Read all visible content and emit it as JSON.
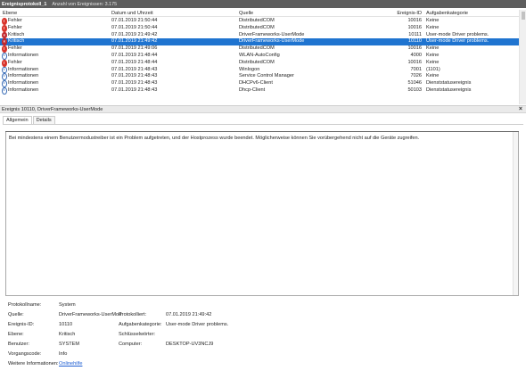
{
  "titlebar": {
    "name": "Ereignisprotokoll_1",
    "count": "Anzahl von Ereignissen: 3.175"
  },
  "columns": {
    "level": "Ebene",
    "date": "Datum und Uhrzeit",
    "source": "Quelle",
    "id": "Ereignis-ID",
    "category": "Aufgabenkategorie"
  },
  "rows": [
    {
      "icon": "err",
      "level": "Fehler",
      "date": "07.01.2019 21:50:44",
      "source": "DistributedCOM",
      "id": "10016",
      "category": "Keine"
    },
    {
      "icon": "err",
      "level": "Fehler",
      "date": "07.01.2019 21:50:44",
      "source": "DistributedCOM",
      "id": "10016",
      "category": "Keine"
    },
    {
      "icon": "crit",
      "level": "Kritisch",
      "date": "07.01.2019 21:49:42",
      "source": "DriverFrameworks-UserMode",
      "id": "10111",
      "category": "User-mode Driver problems."
    },
    {
      "icon": "crit",
      "level": "Kritisch",
      "date": "07.01.2019 21:49:42",
      "source": "DriverFrameworks-UserMode",
      "id": "10110",
      "category": "User-mode Driver problems."
    },
    {
      "icon": "err",
      "level": "Fehler",
      "date": "07.01.2019 21:49:06",
      "source": "DistributedCOM",
      "id": "10016",
      "category": "Keine"
    },
    {
      "icon": "info",
      "level": "Informationen",
      "date": "07.01.2019 21:48:44",
      "source": "WLAN-AutoConfig",
      "id": "4000",
      "category": "Keine"
    },
    {
      "icon": "err",
      "level": "Fehler",
      "date": "07.01.2019 21:48:44",
      "source": "DistributedCOM",
      "id": "10016",
      "category": "Keine"
    },
    {
      "icon": "info",
      "level": "Informationen",
      "date": "07.01.2019 21:48:43",
      "source": "Winlogon",
      "id": "7001",
      "category": "(1101)"
    },
    {
      "icon": "info",
      "level": "Informationen",
      "date": "07.01.2019 21:48:43",
      "source": "Service Control Manager",
      "id": "7026",
      "category": "Keine"
    },
    {
      "icon": "info",
      "level": "Informationen",
      "date": "07.01.2019 21:48:43",
      "source": "DHCPv6-Client",
      "id": "51046",
      "category": "Dienststatusereignis"
    },
    {
      "icon": "info",
      "level": "Informationen",
      "date": "07.01.2019 21:48:43",
      "source": "Dhcp-Client",
      "id": "50103",
      "category": "Dienststatusereignis"
    }
  ],
  "selected_row": 3,
  "detail": {
    "header": "Ereignis 10110, DriverFrameworks-UserMode",
    "tabs": [
      "Allgemein",
      "Details"
    ],
    "message": "Bei mindestens einem Benutzermodustreiber ist ein Problem aufgetreten, und der Hostprozess wurde beendet. Möglicherweise können Sie vorübergehend nicht auf die Geräte zugreifen."
  },
  "props": {
    "log_label": "Protokollname:",
    "log_value": "System",
    "source_label": "Quelle:",
    "source_value": "DriverFrameworks-UserMod",
    "logged_label": "Protokolliert:",
    "logged_value": "07.01.2019 21:49:42",
    "eventid_label": "Ereignis-ID:",
    "eventid_value": "10110",
    "taskcat_label": "Aufgabenkategorie:",
    "taskcat_value": "User-mode Driver problems.",
    "level_label": "Ebene:",
    "level_value": "Kritisch",
    "keywords_label": "Schlüsselwörter:",
    "keywords_value": "",
    "user_label": "Benutzer:",
    "user_value": "SYSTEM",
    "computer_label": "Computer:",
    "computer_value": "DESKTOP-UV3NCJ9",
    "opcode_label": "Vorgangscode:",
    "opcode_value": "Info",
    "moreinfo_label": "Weitere Informationen:",
    "moreinfo_link": "Onlinehilfe"
  },
  "icons": {
    "close": "close-icon",
    "error": "error-icon",
    "critical": "critical-icon",
    "info": "info-icon"
  },
  "colors": {
    "selection": "#1f74d0",
    "error": "#d8332a",
    "info": "#3a6db7"
  }
}
